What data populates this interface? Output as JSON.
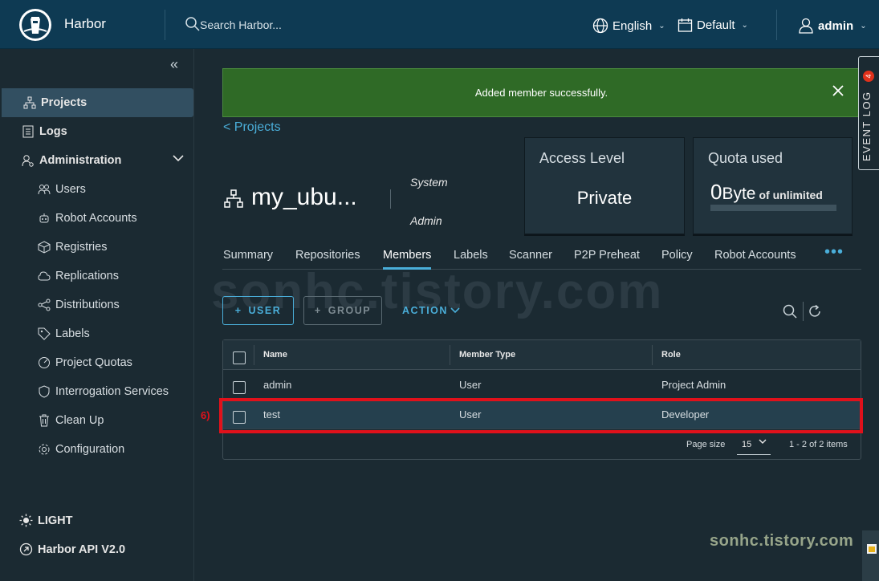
{
  "header": {
    "brand": "Harbor",
    "search_placeholder": "Search Harbor...",
    "language": "English",
    "datetime_format": "Default",
    "user": "admin"
  },
  "sidebar": {
    "items": [
      {
        "label": "Projects",
        "icon": "projects-icon"
      },
      {
        "label": "Logs",
        "icon": "logs-icon"
      },
      {
        "label": "Administration",
        "icon": "administration-icon"
      }
    ],
    "admin_items": [
      {
        "label": "Users",
        "icon": "users-icon"
      },
      {
        "label": "Robot Accounts",
        "icon": "robot-icon"
      },
      {
        "label": "Registries",
        "icon": "registries-icon"
      },
      {
        "label": "Replications",
        "icon": "replications-icon"
      },
      {
        "label": "Distributions",
        "icon": "distributions-icon"
      },
      {
        "label": "Labels",
        "icon": "labels-icon"
      },
      {
        "label": "Project Quotas",
        "icon": "quotas-icon"
      },
      {
        "label": "Interrogation Services",
        "icon": "interrogation-icon"
      },
      {
        "label": "Clean Up",
        "icon": "cleanup-icon"
      },
      {
        "label": "Configuration",
        "icon": "configuration-icon"
      }
    ],
    "theme_toggle": "LIGHT",
    "api_link": "Harbor API V2.0"
  },
  "alert": {
    "message": "Added member successfully."
  },
  "breadcrumb": {
    "back": "<  Projects"
  },
  "project": {
    "name": "my_ubu...",
    "meta_system": "System",
    "meta_admin": "Admin"
  },
  "access_card": {
    "title": "Access Level",
    "value": "Private"
  },
  "quota_card": {
    "title": "Quota used",
    "amount": "0",
    "unit": "Byte",
    "suffix": "of unlimited",
    "usage_fraction": 0
  },
  "tabs": [
    "Summary",
    "Repositories",
    "Members",
    "Labels",
    "Scanner",
    "P2P Preheat",
    "Policy",
    "Robot Accounts"
  ],
  "tabs_more": "•••",
  "watermark": "sonhc.tistory.com",
  "toolbar": {
    "user_button": "USER",
    "group_button": "GROUP",
    "action_button": "ACTION"
  },
  "members_table": {
    "columns": [
      "Name",
      "Member Type",
      "Role"
    ],
    "rows": [
      {
        "name": "admin",
        "type": "User",
        "role": "Project Admin"
      },
      {
        "name": "test",
        "type": "User",
        "role": "Developer"
      }
    ],
    "page_size_label": "Page size",
    "page_size": "15",
    "pagination": "1 - 2 of 2 items"
  },
  "annotation": {
    "step": "6)"
  },
  "event_log": {
    "label": "EVENT LOG",
    "count": "4"
  },
  "bottom_watermark": "sonhc.tistory.com",
  "colors": {
    "header_bg": "#0e3a53",
    "accent": "#4aaed9",
    "alert_bg": "#2f6a26",
    "highlight": "#e0111b"
  }
}
